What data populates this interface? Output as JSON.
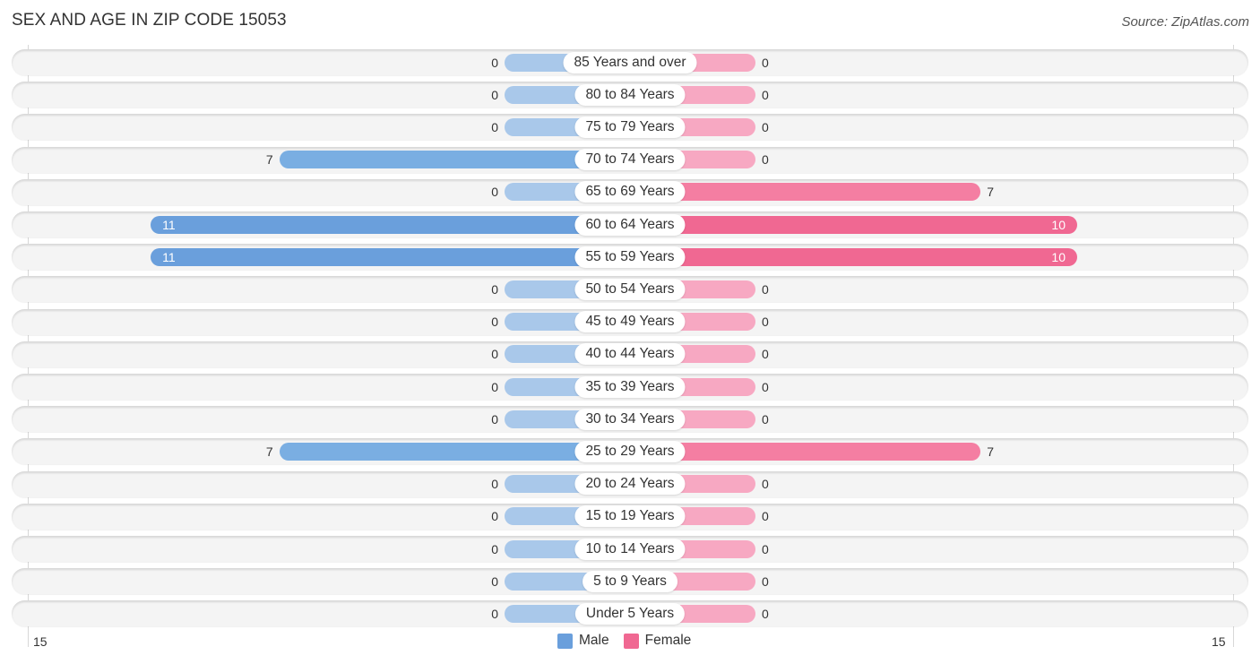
{
  "header": {
    "title": "SEX AND AGE IN ZIP CODE 15053",
    "source": "Source: ZipAtlas.com"
  },
  "colors": {
    "male_full": "#6a9fdc",
    "male_light": "#a9c8ea",
    "female_full": "#f06892",
    "female_light": "#f7a8c2",
    "row_bg": "#f4f4f4"
  },
  "chart_data": {
    "type": "bar",
    "orientation": "horizontal-diverging",
    "title": "SEX AND AGE IN ZIP CODE 15053",
    "categories": [
      "85 Years and over",
      "80 to 84 Years",
      "75 to 79 Years",
      "70 to 74 Years",
      "65 to 69 Years",
      "60 to 64 Years",
      "55 to 59 Years",
      "50 to 54 Years",
      "45 to 49 Years",
      "40 to 44 Years",
      "35 to 39 Years",
      "30 to 34 Years",
      "25 to 29 Years",
      "20 to 24 Years",
      "15 to 19 Years",
      "10 to 14 Years",
      "5 to 9 Years",
      "Under 5 Years"
    ],
    "series": [
      {
        "name": "Male",
        "values": [
          0,
          0,
          0,
          7,
          0,
          11,
          11,
          0,
          0,
          0,
          0,
          0,
          7,
          0,
          0,
          0,
          0,
          0
        ]
      },
      {
        "name": "Female",
        "values": [
          0,
          0,
          0,
          0,
          7,
          10,
          10,
          0,
          0,
          0,
          0,
          0,
          7,
          0,
          0,
          0,
          0,
          0
        ]
      }
    ],
    "xlim": [
      -15,
      15
    ],
    "axis_tick_labels": {
      "left": "15",
      "right": "15"
    },
    "legend": {
      "entries": [
        "Male",
        "Female"
      ],
      "placement": "bottom-center"
    },
    "grid": false
  }
}
